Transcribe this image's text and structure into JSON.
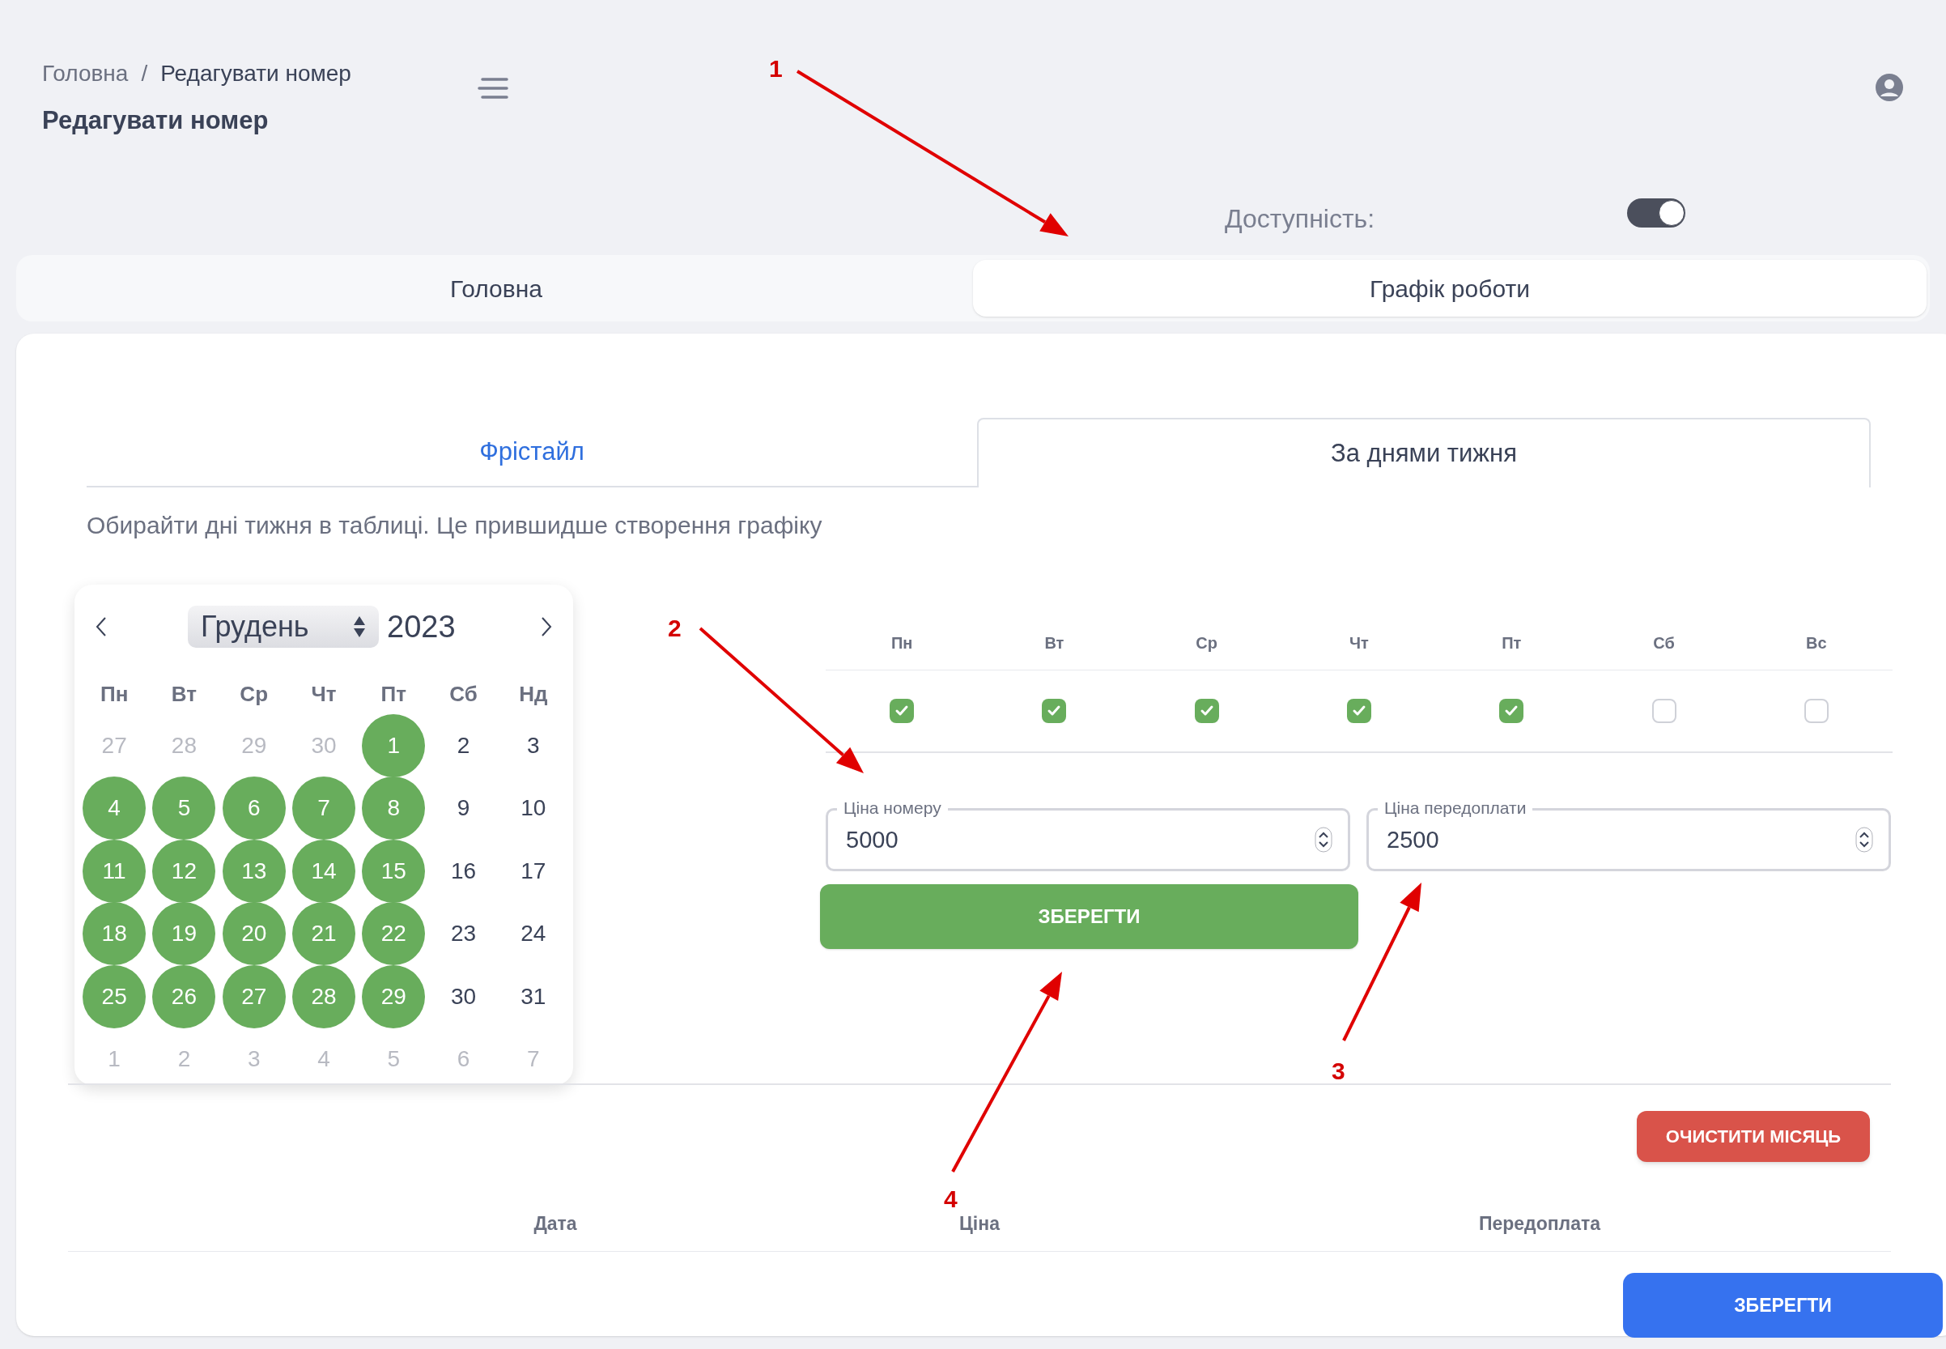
{
  "breadcrumb": {
    "items": [
      "Головна",
      "Редагувати номер"
    ],
    "separator": "/"
  },
  "page_title": "Редагувати номер",
  "availability": {
    "label": "Доступність:",
    "on": true
  },
  "tabs": [
    {
      "label": "Головна",
      "selected": false
    },
    {
      "label": "Графік роботи",
      "selected": true
    }
  ],
  "sub_tabs": [
    {
      "label": "Фрістайл",
      "selected": false
    },
    {
      "label": "За днями тижня",
      "selected": true
    }
  ],
  "hint": "Обирайти дні тижня в таблиці. Це прившидше створення графіку",
  "calendar": {
    "month": "Грудень",
    "year": "2023",
    "weekdays": [
      "Пн",
      "Вт",
      "Ср",
      "Чт",
      "Пт",
      "Сб",
      "Нд"
    ],
    "days": [
      {
        "text": "27",
        "muted": true,
        "selected": false
      },
      {
        "text": "28",
        "muted": true,
        "selected": false
      },
      {
        "text": "29",
        "muted": true,
        "selected": false
      },
      {
        "text": "30",
        "muted": true,
        "selected": false
      },
      {
        "text": "1",
        "muted": false,
        "selected": true
      },
      {
        "text": "2",
        "muted": false,
        "selected": false
      },
      {
        "text": "3",
        "muted": false,
        "selected": false
      },
      {
        "text": "4",
        "muted": false,
        "selected": true
      },
      {
        "text": "5",
        "muted": false,
        "selected": true
      },
      {
        "text": "6",
        "muted": false,
        "selected": true
      },
      {
        "text": "7",
        "muted": false,
        "selected": true
      },
      {
        "text": "8",
        "muted": false,
        "selected": true
      },
      {
        "text": "9",
        "muted": false,
        "selected": false
      },
      {
        "text": "10",
        "muted": false,
        "selected": false
      },
      {
        "text": "11",
        "muted": false,
        "selected": true
      },
      {
        "text": "12",
        "muted": false,
        "selected": true
      },
      {
        "text": "13",
        "muted": false,
        "selected": true
      },
      {
        "text": "14",
        "muted": false,
        "selected": true
      },
      {
        "text": "15",
        "muted": false,
        "selected": true
      },
      {
        "text": "16",
        "muted": false,
        "selected": false
      },
      {
        "text": "17",
        "muted": false,
        "selected": false
      },
      {
        "text": "18",
        "muted": false,
        "selected": true
      },
      {
        "text": "19",
        "muted": false,
        "selected": true
      },
      {
        "text": "20",
        "muted": false,
        "selected": true
      },
      {
        "text": "21",
        "muted": false,
        "selected": true
      },
      {
        "text": "22",
        "muted": false,
        "selected": true
      },
      {
        "text": "23",
        "muted": false,
        "selected": false
      },
      {
        "text": "24",
        "muted": false,
        "selected": false
      },
      {
        "text": "25",
        "muted": false,
        "selected": true
      },
      {
        "text": "26",
        "muted": false,
        "selected": true
      },
      {
        "text": "27",
        "muted": false,
        "selected": true
      },
      {
        "text": "28",
        "muted": false,
        "selected": true
      },
      {
        "text": "29",
        "muted": false,
        "selected": true
      },
      {
        "text": "30",
        "muted": false,
        "selected": false
      },
      {
        "text": "31",
        "muted": false,
        "selected": false
      },
      {
        "text": "1",
        "muted": true,
        "selected": false
      },
      {
        "text": "2",
        "muted": true,
        "selected": false
      },
      {
        "text": "3",
        "muted": true,
        "selected": false
      },
      {
        "text": "4",
        "muted": true,
        "selected": false
      },
      {
        "text": "5",
        "muted": true,
        "selected": false
      },
      {
        "text": "6",
        "muted": true,
        "selected": false
      },
      {
        "text": "7",
        "muted": true,
        "selected": false
      }
    ]
  },
  "weekday_table": [
    {
      "label": "Пн",
      "checked": true
    },
    {
      "label": "Вт",
      "checked": true
    },
    {
      "label": "Ср",
      "checked": true
    },
    {
      "label": "Чт",
      "checked": true
    },
    {
      "label": "Пт",
      "checked": true
    },
    {
      "label": "Сб",
      "checked": false
    },
    {
      "label": "Вс",
      "checked": false
    }
  ],
  "fields": [
    {
      "label": "Ціна номеру",
      "value": "5000"
    },
    {
      "label": "Ціна передоплати",
      "value": "2500"
    }
  ],
  "save_button": "ЗБЕРЕГТИ",
  "clear_button": "ОЧИСТИТИ МІСЯЦЬ",
  "table_columns": [
    "Дата",
    "Ціна",
    "Передоплата"
  ],
  "footer_button": "ЗБЕРЕГТИ",
  "annotations": [
    {
      "label": "1"
    },
    {
      "label": "2"
    },
    {
      "label": "3"
    },
    {
      "label": "4"
    }
  ]
}
